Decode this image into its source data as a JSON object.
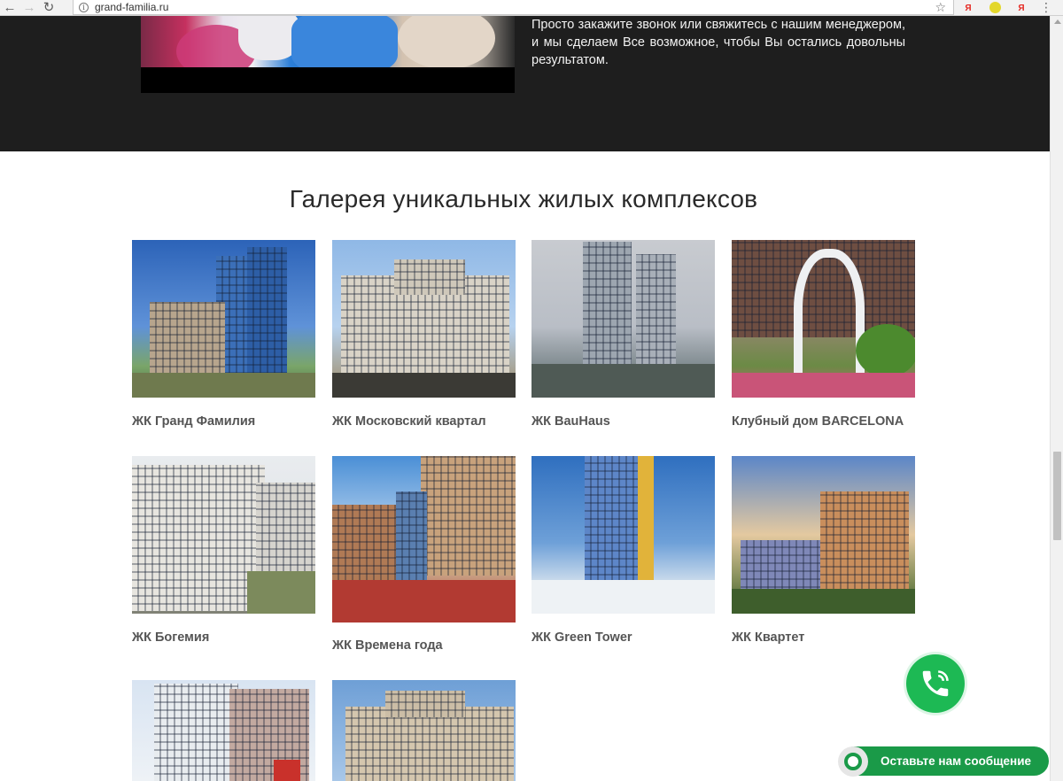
{
  "browser": {
    "url": "grand-familia.ru",
    "back_icon": "arrow-left-icon",
    "forward_icon": "arrow-right-icon",
    "reload_icon": "reload-icon",
    "bookmark_icon": "star-icon",
    "ext1": "Я",
    "ext3": "Я"
  },
  "intro": {
    "text": "Просто закажите звонок или свяжитесь с нашим менеджером, и мы сделаем Все возможное, чтобы Вы остались довольны результатом."
  },
  "gallery": {
    "title": "Галерея уникальных жилых комплексов",
    "items": [
      {
        "caption": "ЖК Гранд Фамилия"
      },
      {
        "caption": "ЖК Московский квартал"
      },
      {
        "caption": "ЖК BauHaus"
      },
      {
        "caption": "Клубный дом BARCELONA"
      },
      {
        "caption": "ЖК Богемия"
      },
      {
        "caption": "ЖК Времена года"
      },
      {
        "caption": "ЖК Green Tower"
      },
      {
        "caption": "ЖК Квартет"
      },
      {
        "caption": ""
      },
      {
        "caption": ""
      }
    ]
  },
  "widgets": {
    "call_icon": "phone-icon",
    "message_label": "Оставьте нам сообщение"
  },
  "colors": {
    "dark_bg": "#1e1e1e",
    "accent_green": "#1db954",
    "caption": "#555555"
  }
}
